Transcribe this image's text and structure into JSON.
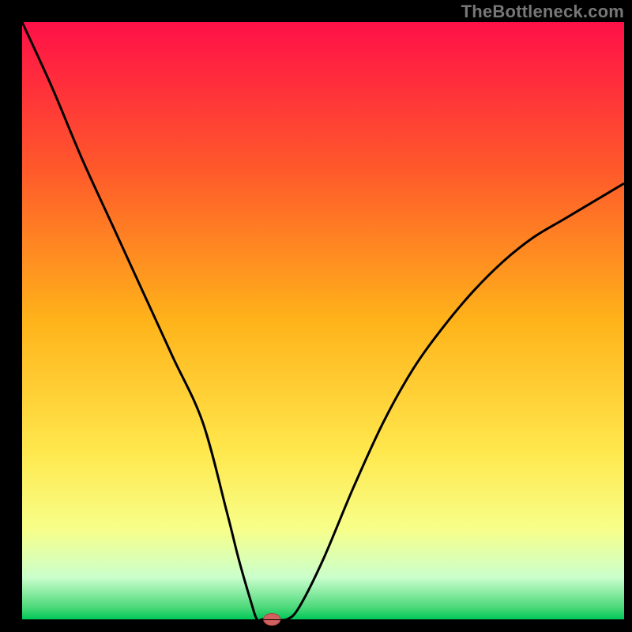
{
  "watermark": "TheBottleneck.com",
  "colors": {
    "frame": "#000000",
    "curve": "#000000",
    "marker_fill": "#d1605e",
    "marker_stroke": "#a94442",
    "gradient_stops": [
      {
        "offset": 0.0,
        "color": "#ff1048"
      },
      {
        "offset": 0.25,
        "color": "#ff5a2a"
      },
      {
        "offset": 0.5,
        "color": "#ffb31a"
      },
      {
        "offset": 0.72,
        "color": "#ffe84d"
      },
      {
        "offset": 0.85,
        "color": "#f7ff8a"
      },
      {
        "offset": 0.93,
        "color": "#caffcc"
      },
      {
        "offset": 0.98,
        "color": "#4cd97a"
      },
      {
        "offset": 1.0,
        "color": "#00c859"
      }
    ]
  },
  "chart_data": {
    "type": "line",
    "title": "",
    "xlabel": "",
    "ylabel": "",
    "xlim": [
      0,
      100
    ],
    "ylim": [
      0,
      100
    ],
    "x": [
      0,
      5,
      10,
      15,
      20,
      25,
      30,
      34,
      36,
      38,
      39,
      40,
      42,
      44,
      46,
      50,
      55,
      60,
      65,
      70,
      75,
      80,
      85,
      90,
      95,
      100
    ],
    "values": [
      100,
      89,
      77,
      66,
      55,
      44,
      33,
      18,
      10,
      3,
      0,
      0,
      0,
      0,
      2,
      10,
      22,
      33,
      42,
      49,
      55,
      60,
      64,
      67,
      70,
      73
    ],
    "marker": {
      "x": 41.5,
      "y": 0,
      "rx": 1.4,
      "ry": 1.0
    }
  }
}
